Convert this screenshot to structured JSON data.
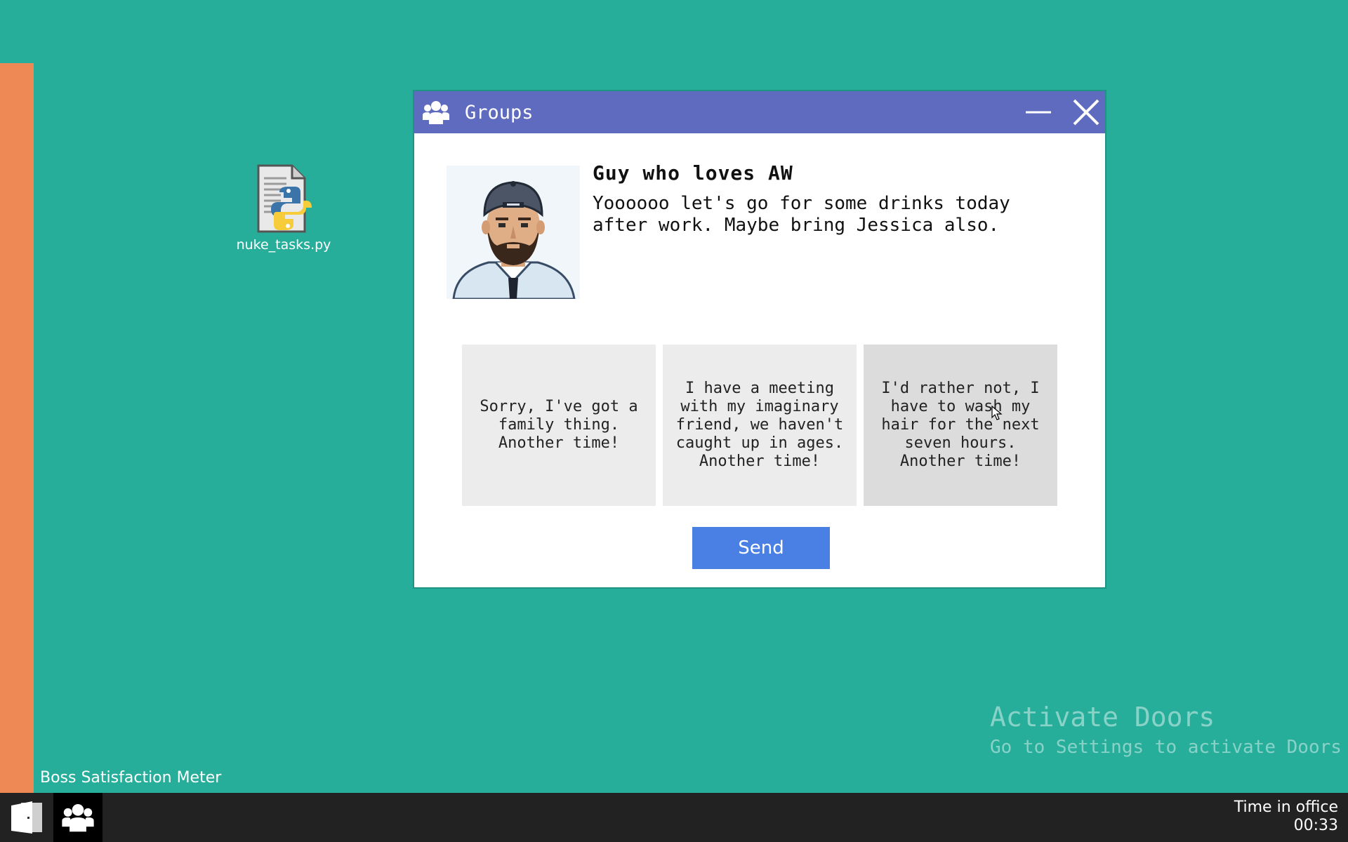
{
  "desktop": {
    "icons": [
      {
        "label": "nuke_tasks.py",
        "icon": "python-file-icon"
      }
    ]
  },
  "boss_meter": {
    "label": "Boss Satisfaction Meter",
    "level": 0.92,
    "color": "#ee8855"
  },
  "window": {
    "title": "Groups",
    "title_icon": "groups-icon",
    "minimize_icon": "minimize-icon",
    "close_icon": "close-icon",
    "sender_name": "Guy who loves AW",
    "message": "Yoooooo let's go for some drinks today after work. Maybe bring Jessica also.",
    "reply_options": [
      "Sorry, I've got a family thing. Another time!",
      "I have a meeting with my imaginary friend, we haven't caught up in ages. Another time!",
      "I'd rather not, I have to wash my hair for the next seven hours. Another time!"
    ],
    "send_label": "Send"
  },
  "watermark": {
    "title": "Activate Doors",
    "subtitle": "Go to Settings to activate Doors"
  },
  "taskbar": {
    "start_icon": "door-icon",
    "groups_icon": "groups-icon",
    "clock_label": "Time in office",
    "clock_value": "00:33"
  },
  "colors": {
    "desktop": "#27ae9b",
    "titlebar": "#5f6bbe",
    "send_button": "#4a7fe3",
    "taskbar": "#222222"
  }
}
